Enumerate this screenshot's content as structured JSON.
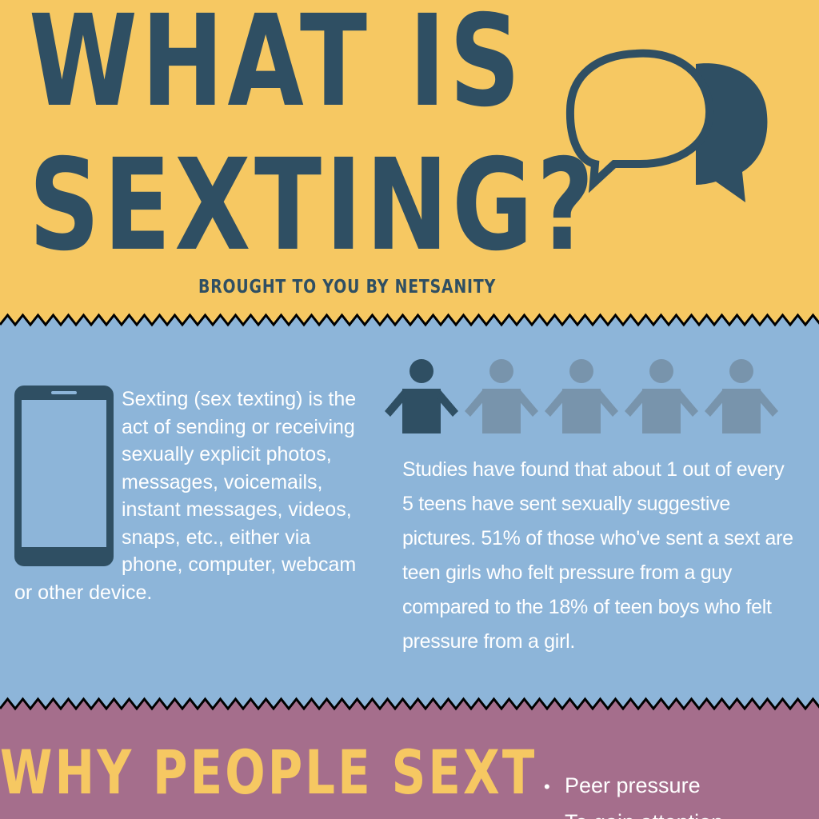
{
  "colors": {
    "yellow": "#f6c862",
    "blue": "#8db5d9",
    "purple": "#a56e8c",
    "navy": "#2f4f63",
    "person_light": "#7894ac",
    "white": "#ffffff",
    "zigzag": "#000000"
  },
  "header": {
    "title_line1": "WHAT IS",
    "title_line2": "SEXTING?",
    "byline": "BROUGHT TO YOU BY NETSANITY",
    "icon": "speech-bubbles-icon"
  },
  "info": {
    "phone_icon": "smartphone-icon",
    "definition": "Sexting (sex texting) is the act of sending or receiving sexually explicit photos, messages, voicemails, instant messages, videos, snaps, etc., either via phone, computer, webcam or other device.",
    "people_icon": "person-icon",
    "people_total": 5,
    "people_highlighted": 1,
    "stats": "Studies have found that about 1 out of every 5 teens have sent sexually suggestive pictures. 51% of those who've sent a sext are teen girls who felt pressure from a guy compared to the 18% of teen boys who felt pressure from a girl."
  },
  "why": {
    "title": "WHY PEOPLE SEXT",
    "reasons": [
      "Peer pressure",
      "To gain attention"
    ]
  }
}
